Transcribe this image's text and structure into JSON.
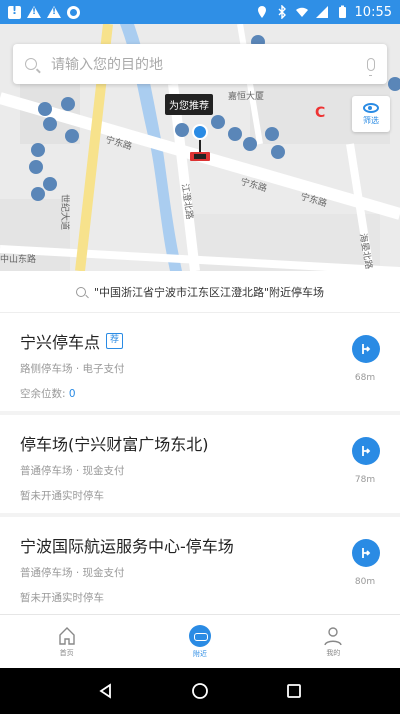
{
  "status_bar": {
    "time": "10:55"
  },
  "map": {
    "search_placeholder": "请输入您的目的地",
    "recommend_label": "为您推荐",
    "filter_label": "筛选",
    "road_labels": [
      "宁东路",
      "宁东路",
      "宁东路",
      "世纪大道",
      "江澄北路",
      "海晏北路",
      "中山东路",
      "嘉恒大厦"
    ]
  },
  "nearby_banner": "\"中国浙江省宁波市江东区江澄北路\"附近停车场",
  "parking_list": [
    {
      "name": "宁兴停车点",
      "badge": "荐",
      "tags": "路侧停车场 · 电子支付",
      "info_label": "空余位数: ",
      "info_value": "0",
      "distance": "68m"
    },
    {
      "name": "停车场(宁兴财富广场东北)",
      "tags": "普通停车场 · 现金支付",
      "info_label": "暂未开通实时停车",
      "info_value": "",
      "distance": "78m"
    },
    {
      "name": "宁波国际航运服务中心-停车场",
      "tags": "普通停车场 · 现金支付",
      "info_label": "暂未开通实时停车",
      "info_value": "",
      "distance": "80m"
    }
  ],
  "tabs": [
    {
      "label": "首页"
    },
    {
      "label": "附近"
    },
    {
      "label": "我的"
    }
  ],
  "colors": {
    "accent": "#2a8be4",
    "status_bar": "#2f8fe6"
  }
}
